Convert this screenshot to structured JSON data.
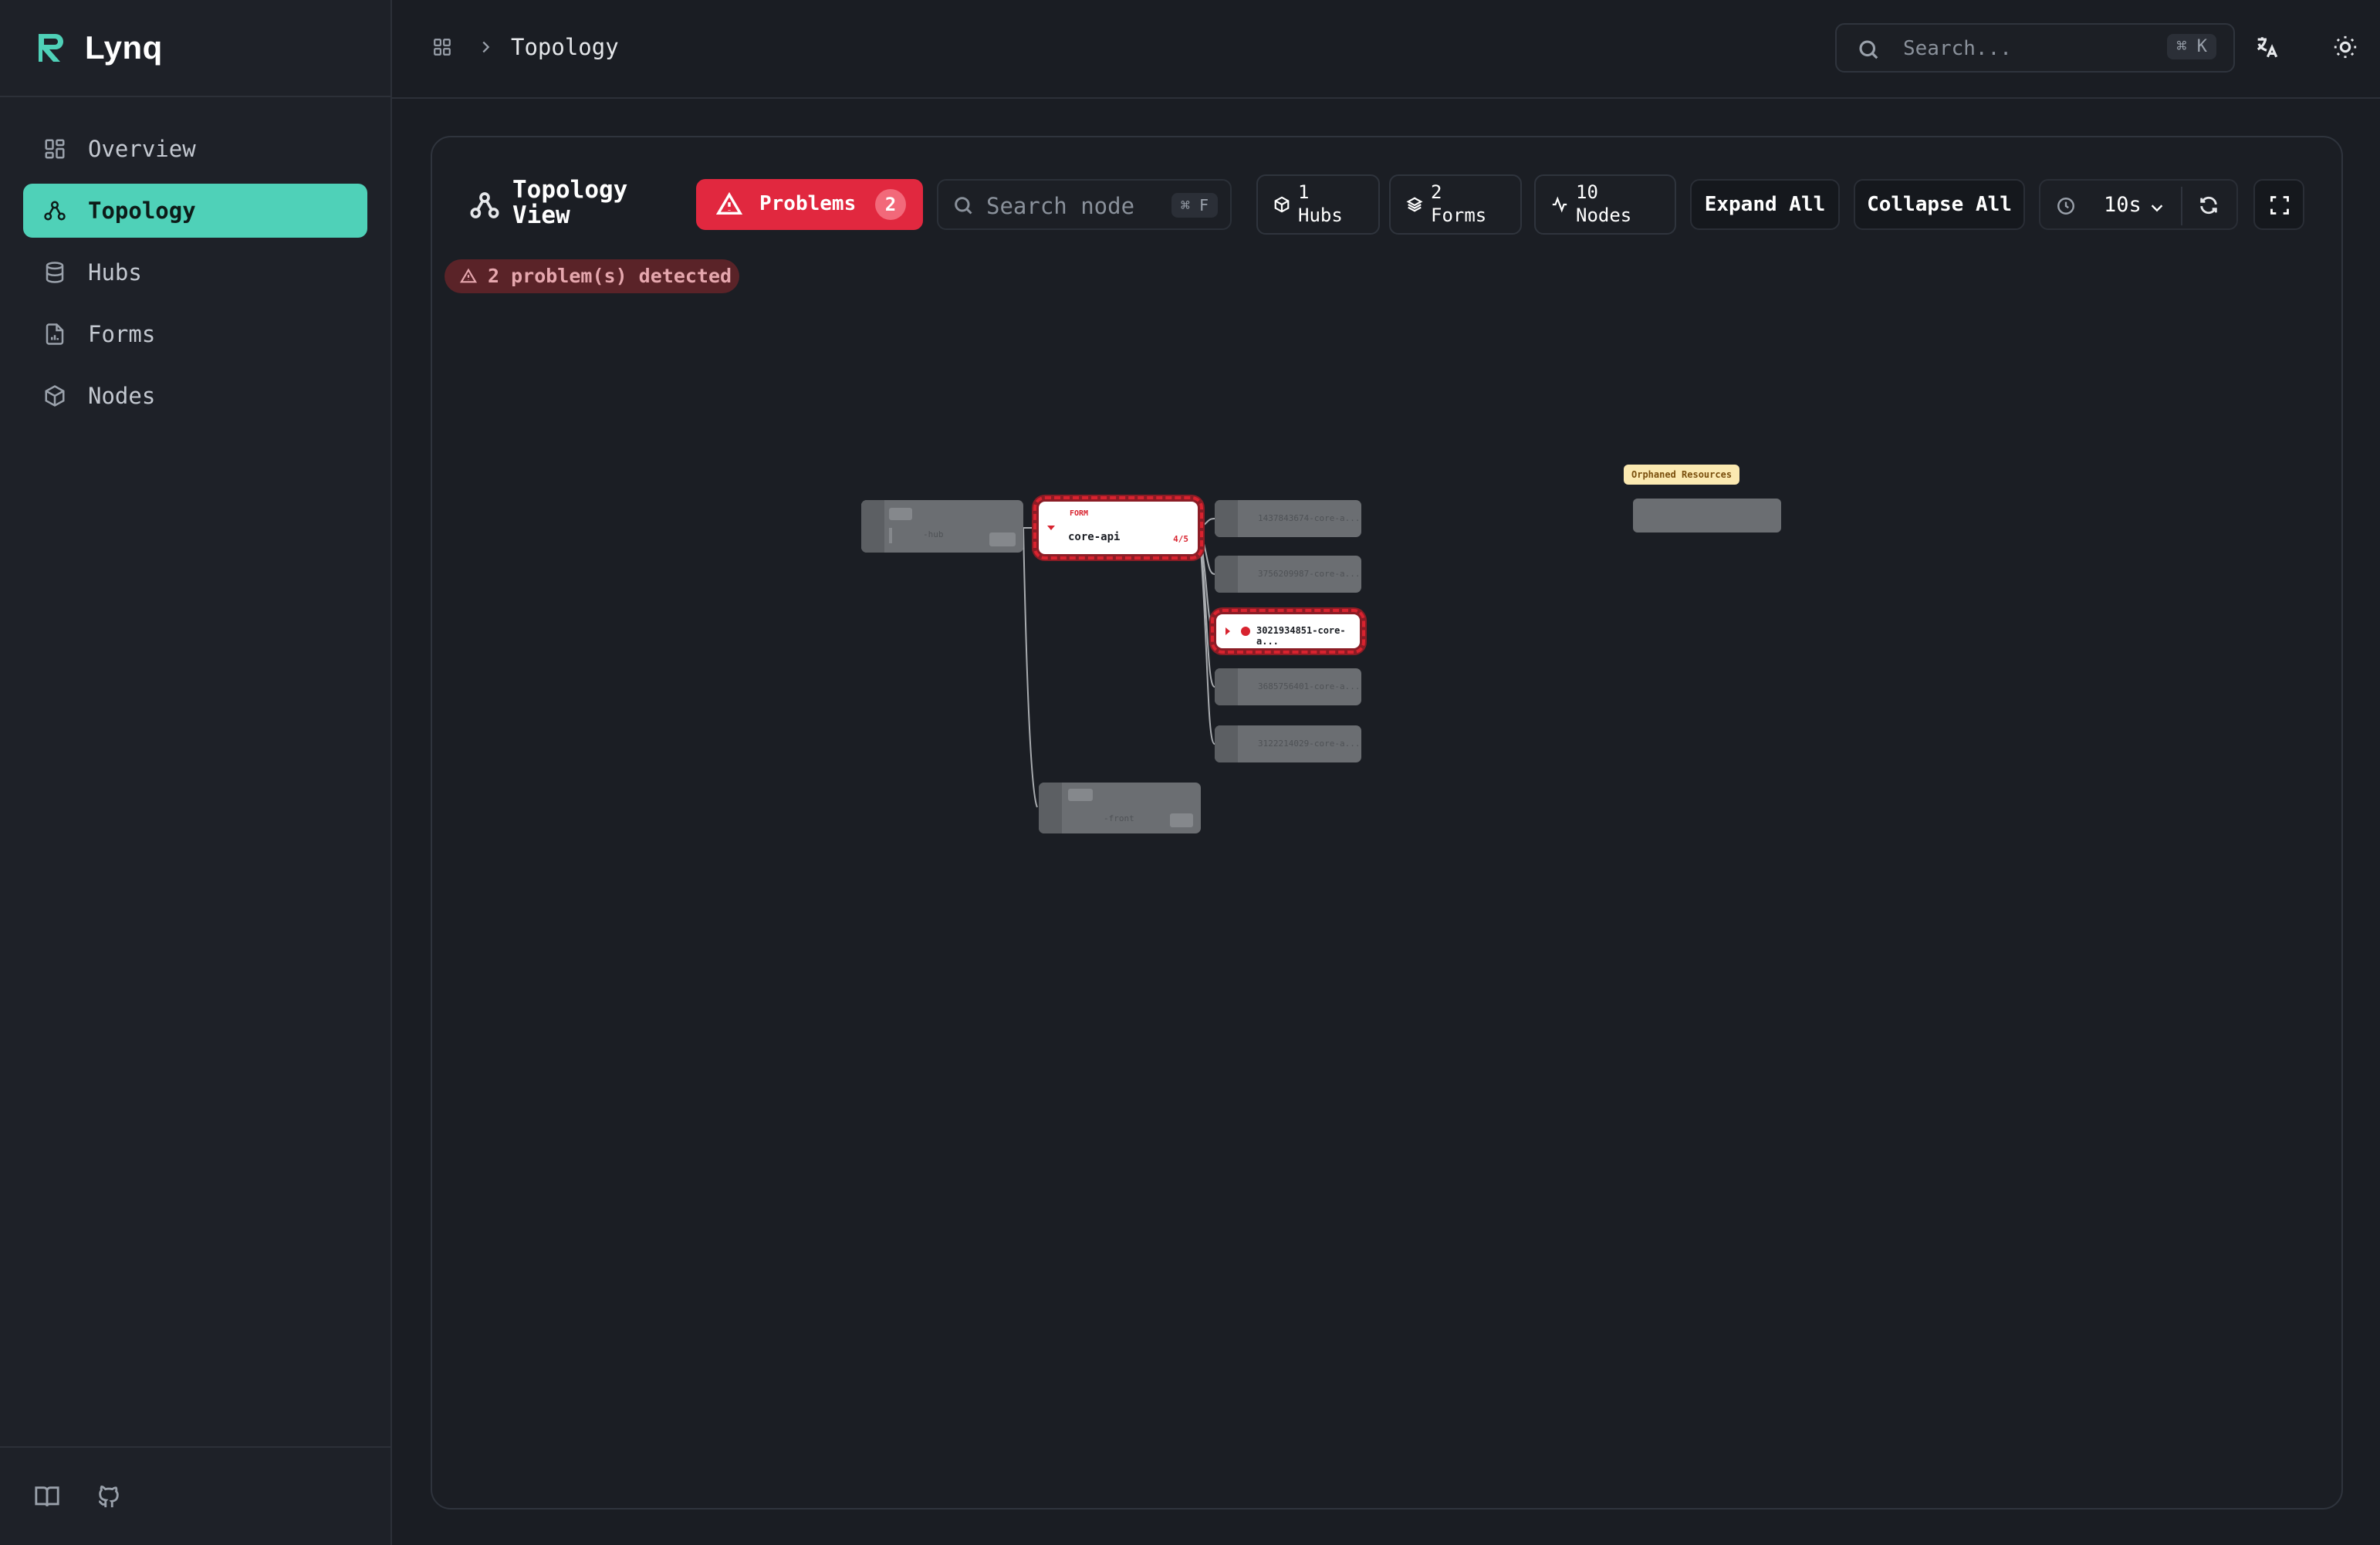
{
  "app": {
    "name": "Lynq"
  },
  "sidebar": {
    "items": [
      {
        "label": "Overview",
        "icon": "grid-icon",
        "active": false
      },
      {
        "label": "Topology",
        "icon": "topology-icon",
        "active": true
      },
      {
        "label": "Hubs",
        "icon": "database-icon",
        "active": false
      },
      {
        "label": "Forms",
        "icon": "file-chart-icon",
        "active": false
      },
      {
        "label": "Nodes",
        "icon": "box-icon",
        "active": false
      }
    ],
    "footer_icons": [
      "book-icon",
      "github-icon"
    ]
  },
  "header": {
    "breadcrumb": {
      "current": "Topology"
    },
    "search": {
      "placeholder": "Search...",
      "shortcut": "⌘ K"
    },
    "icons": [
      "translate-icon",
      "sun-icon"
    ]
  },
  "toolbar": {
    "title": "Topology View",
    "problems": {
      "label": "Problems",
      "count": "2"
    },
    "node_search": {
      "placeholder": "Search node",
      "shortcut": "⌘ F"
    },
    "stats": [
      {
        "value": "1",
        "unit": "Hubs",
        "icon": "box-icon"
      },
      {
        "value": "2",
        "unit": "Forms",
        "icon": "layers-icon"
      },
      {
        "value": "10",
        "unit": "Nodes",
        "icon": "activity-icon"
      }
    ],
    "expand_all": "Expand All",
    "collapse_all": "Collapse All",
    "refresh_interval": "10s"
  },
  "problem_banner": "2 problem(s) detected",
  "graph": {
    "hub": {
      "label": "-hub"
    },
    "form_core_api": {
      "tag": "FORM",
      "name": "core-api",
      "ratio": "4/5"
    },
    "form_frontend": {
      "label": "-front"
    },
    "nodes": [
      {
        "label": "1437843674-core-a...",
        "problem": false
      },
      {
        "label": "3756209987-core-a...",
        "problem": false
      },
      {
        "label": "3021934851-core-a...",
        "problem": true
      },
      {
        "label": "3685756401-core-a...",
        "problem": false
      },
      {
        "label": "3122214029-core-a...",
        "problem": false
      }
    ],
    "orphaned_label": "Orphaned Resources"
  },
  "colors": {
    "accent": "#4fd1b8",
    "danger": "#e1283f",
    "background": "#1a1d23",
    "node_dim": "#6b6e72"
  }
}
